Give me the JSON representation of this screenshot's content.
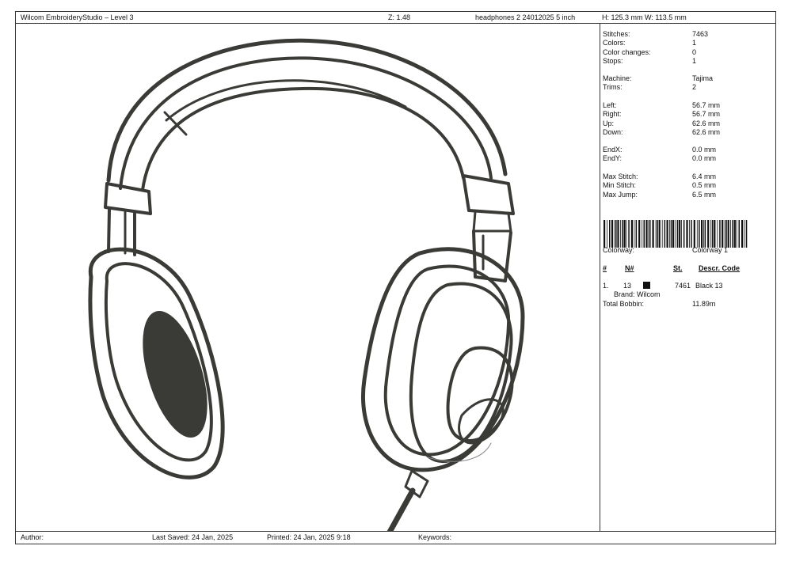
{
  "header": {
    "app_title": "Wilcom EmbroideryStudio – Level 3",
    "zoom": "Z: 1.48",
    "design_name": "headphones 2 24012025 5 inch",
    "dimensions": "H: 125.3 mm   W: 113.5 mm"
  },
  "stats": {
    "group1": [
      {
        "label": "Stitches:",
        "value": "7463"
      },
      {
        "label": "Colors:",
        "value": "1"
      },
      {
        "label": "Color changes:",
        "value": "0"
      },
      {
        "label": "Stops:",
        "value": "1"
      }
    ],
    "group2": [
      {
        "label": "Machine:",
        "value": "Tajima"
      },
      {
        "label": "Trims:",
        "value": "2"
      }
    ],
    "group3": [
      {
        "label": "Left:",
        "value": "56.7 mm"
      },
      {
        "label": "Right:",
        "value": "56.7 mm"
      },
      {
        "label": "Up:",
        "value": "62.6 mm"
      },
      {
        "label": "Down:",
        "value": "62.6 mm"
      }
    ],
    "group4": [
      {
        "label": "EndX:",
        "value": "0.0 mm"
      },
      {
        "label": "EndY:",
        "value": "0.0 mm"
      }
    ],
    "group5": [
      {
        "label": "Max Stitch:",
        "value": "6.4 mm"
      },
      {
        "label": "Min Stitch:",
        "value": "0.5 mm"
      },
      {
        "label": "Max Jump:",
        "value": "6.5 mm"
      }
    ]
  },
  "colorway": {
    "label": "Colorway:",
    "value": "Colorway 1"
  },
  "color_table": {
    "headers": {
      "num": "#",
      "n": "N#",
      "st": "St.",
      "descr": "Descr. Code"
    },
    "row": {
      "num": "1.",
      "n": "13",
      "swatch_color": "#111111",
      "st": "7461",
      "descr": "Black 13",
      "brand": "Brand: Wilcom"
    }
  },
  "bobbin": {
    "label": "Total Bobbin:",
    "value": "11.89m"
  },
  "footer": {
    "author": "Author:",
    "last_saved": "Last Saved: 24 Jan, 2025",
    "printed": "Printed: 24 Jan, 2025  9:18",
    "keywords": "Keywords:"
  },
  "colors": {
    "thread": "#3a3a36",
    "border": "#333333"
  }
}
